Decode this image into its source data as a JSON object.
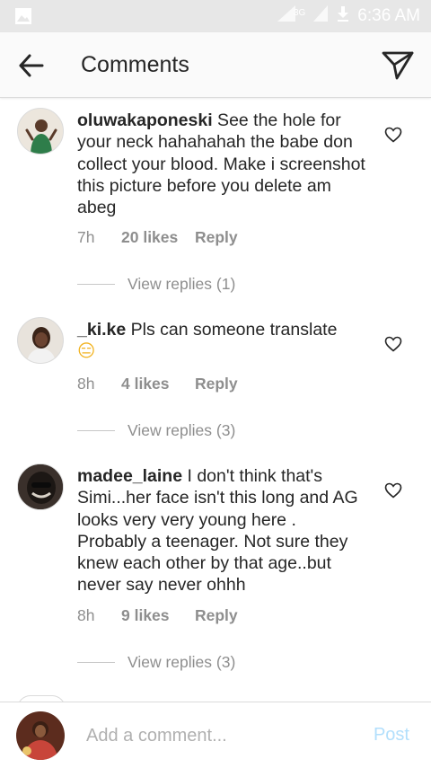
{
  "status_bar": {
    "time": "6:36 AM",
    "network": "3G"
  },
  "header": {
    "title": "Comments"
  },
  "comments": [
    {
      "username": "oluwakaponeski",
      "text": " See the hole for your neck hahahahah the babe don collect your blood. Make i screenshot this picture before you delete am abeg",
      "time": "7h",
      "likes": "20 likes",
      "reply_label": "Reply",
      "view_replies": "View replies (1)"
    },
    {
      "username": "_ki.ke",
      "text": " Pls can someone translate",
      "emoji": "😑",
      "time": "8h",
      "likes": "4 likes",
      "reply_label": "Reply",
      "view_replies": "View replies (3)"
    },
    {
      "username": "madee_laine",
      "text": " I don't think that's Simi...her face isn't this long and AG looks very very young here . Probably a teenager. Not sure they knew each other by that age..but never say never ohhh",
      "time": "8h",
      "likes": "9 likes",
      "reply_label": "Reply",
      "view_replies": "View replies (3)"
    }
  ],
  "composer": {
    "placeholder": "Add a comment...",
    "post_label": "Post"
  },
  "colors": {
    "post_disabled": "#b2dffc",
    "meta_gray": "#8e8e8e",
    "status_bar_bg": "#e7e7e7"
  },
  "icons": {
    "back": "arrow-left-icon",
    "send": "paper-plane-icon",
    "like": "heart-outline-icon"
  }
}
